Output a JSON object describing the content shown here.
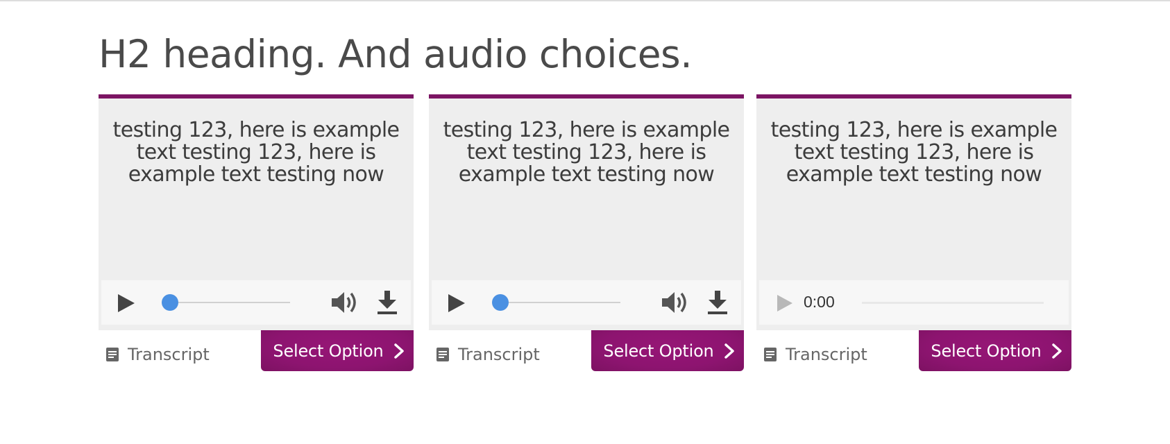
{
  "page": {
    "heading": "H2 heading. And audio choices."
  },
  "colors": {
    "accent": "#7c1563",
    "button": "#8d1470",
    "card_bg": "#eeeeee",
    "player_bg": "#f7f7f7",
    "thumb": "#4a90e2"
  },
  "cards": [
    {
      "text": "testing 123, here is example text testing 123, here is example text testing now",
      "player": {
        "type": "full",
        "progress": 0.05,
        "icons": [
          "play-icon",
          "volume-icon",
          "download-icon"
        ]
      },
      "transcript_label": "Transcript",
      "select_label": "Select Option"
    },
    {
      "text": "testing 123, here is example text testing 123, here is example text testing now",
      "player": {
        "type": "full",
        "progress": 0.05,
        "icons": [
          "play-icon",
          "volume-icon",
          "download-icon"
        ]
      },
      "transcript_label": "Transcript",
      "select_label": "Select Option"
    },
    {
      "text": "testing 123, here is example text testing 123, here is example text testing now",
      "player": {
        "type": "native",
        "time": "0:00",
        "icons": [
          "play-icon"
        ]
      },
      "transcript_label": "Transcript",
      "select_label": "Select Option"
    }
  ]
}
